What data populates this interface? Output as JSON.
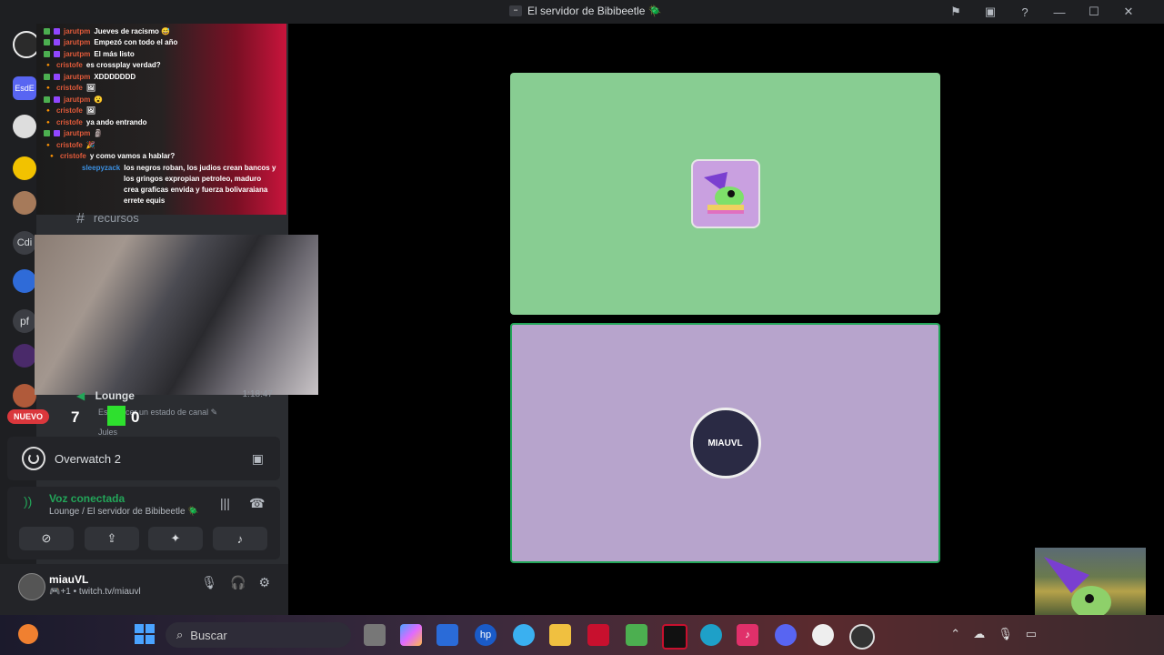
{
  "window": {
    "title": "El servidor de Bibibeetle 🪲"
  },
  "titlebar_icons": [
    "inbox-flag-icon",
    "inbox-icon",
    "help-icon",
    "minimize-icon",
    "maximize-icon",
    "close-icon"
  ],
  "guild_labels": {
    "g2": "EsdE",
    "g7": "Cdi",
    "g9": "pf"
  },
  "chat": {
    "lines": [
      {
        "user": "jarutpm",
        "msg": "Jueves de racismo 😅"
      },
      {
        "user": "jarutpm",
        "msg": "Empezó con todo el año"
      },
      {
        "user": "jarutpm",
        "msg": "El más listo"
      },
      {
        "user": "cristofe",
        "msg": "es crossplay verdad?"
      },
      {
        "user": "jarutpm",
        "msg": "XDDDDDDD"
      },
      {
        "user": "cristofe",
        "msg": "🖼"
      },
      {
        "user": "jarutpm",
        "msg": "😮"
      },
      {
        "user": "cristofe",
        "msg": "🖼"
      },
      {
        "user": "cristofe",
        "msg": "ya ando entrando"
      },
      {
        "user": "jarutpm",
        "msg": "🗿"
      },
      {
        "user": "cristofe",
        "msg": "🎉"
      },
      {
        "user": "cristofe",
        "msg": "y como vamos a hablar?"
      }
    ],
    "sleepy": {
      "user": "sleepyzack",
      "msg1": "los negros roban, los judios crean bancos y",
      "msg2": "los gringos expropian petroleo, maduro",
      "msg3": "crea graficas envida y fuerza bolivaraiana",
      "msg4": "errete equis"
    }
  },
  "channels": {
    "recursos": "recursos"
  },
  "lounge": {
    "name": "Lounge",
    "time": "1:18:47",
    "status": "Establecer un estado de canal",
    "member": "Jules"
  },
  "scoreboard": {
    "nuevo": "NUEVO",
    "left": "7",
    "right": "0"
  },
  "activity": {
    "game": "Overwatch 2"
  },
  "voice": {
    "status": "Voz conectada",
    "location": "Lounge / El servidor de Bibibeetle 🪲"
  },
  "user": {
    "name": "miauVL",
    "status": "🎮+1 • twitch.tv/miauvl"
  },
  "tiles": [
    {
      "color": "#88cd92",
      "avatar_bg": "#c9a0e0"
    },
    {
      "color": "#b7a4cc",
      "avatar_label": "MIAUVL"
    }
  ],
  "taskbar": {
    "search_placeholder": "Buscar"
  }
}
